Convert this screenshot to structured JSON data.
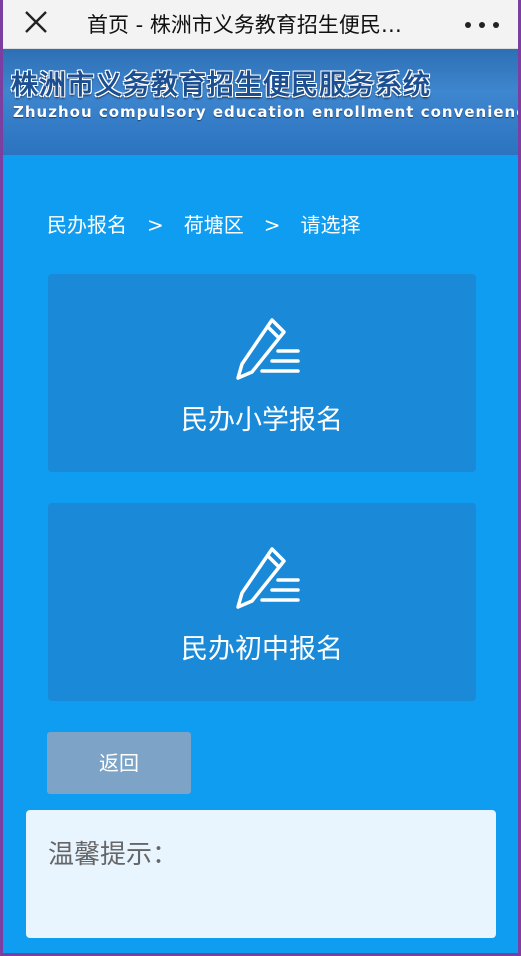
{
  "topbar": {
    "title": "首页 - 株洲市义务教育招生便民…",
    "close_icon": "close-icon",
    "more_icon": "more-icon"
  },
  "banner": {
    "title_cn": "株洲市义务教育招生便民服务系统",
    "title_en": "Zhuzhou compulsory education enrollment convenience serv"
  },
  "breadcrumb": {
    "items": [
      "民办报名",
      "荷塘区",
      "请选择"
    ],
    "separator": ">"
  },
  "cards": [
    {
      "label": "民办小学报名",
      "icon": "pen-icon"
    },
    {
      "label": "民办初中报名",
      "icon": "pen-icon"
    }
  ],
  "back_button": {
    "label": "返回"
  },
  "tip": {
    "title": "温馨提示："
  },
  "colors": {
    "page_bg": "#0e9df0",
    "card_bg": "#1a89d8",
    "back_bg": "#7da3c6",
    "tip_bg": "#e9f5fe",
    "frame_border": "#7a3fa0"
  }
}
